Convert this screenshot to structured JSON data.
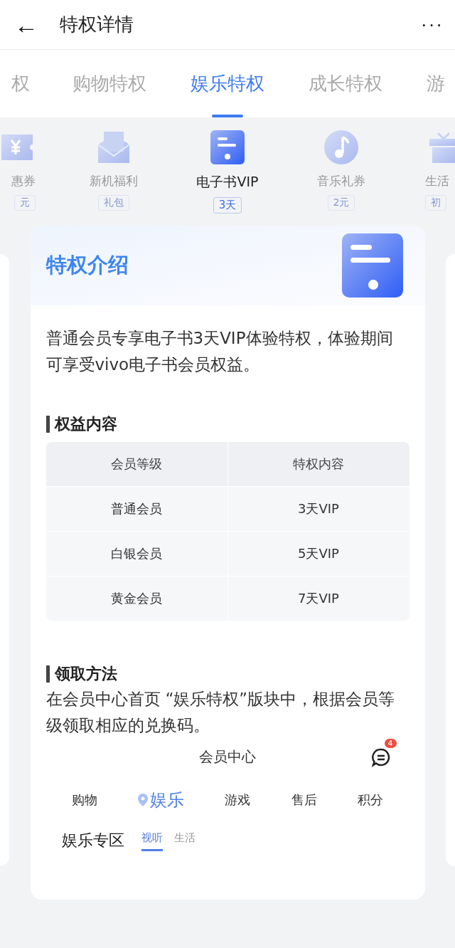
{
  "header": {
    "title": "特权详情",
    "back": "←",
    "more": "···"
  },
  "tabs": [
    {
      "label": "权",
      "selected": false
    },
    {
      "label": "购物特权",
      "selected": false
    },
    {
      "label": "娱乐特权",
      "selected": true
    },
    {
      "label": "成长特权",
      "selected": false
    },
    {
      "label": "游",
      "selected": false
    }
  ],
  "perks": [
    {
      "kind": "ticket",
      "label": "惠券",
      "badge": "元",
      "selected": false
    },
    {
      "kind": "mail",
      "label": "新机福利",
      "badge": "礼包",
      "selected": false
    },
    {
      "kind": "book",
      "label": "电子书VIP",
      "badge": "3天",
      "selected": true
    },
    {
      "kind": "music",
      "label": "音乐礼券",
      "badge": "2元",
      "selected": false
    },
    {
      "kind": "gift",
      "label": "生活",
      "badge": "初",
      "selected": false
    }
  ],
  "card": {
    "title": "特权介绍",
    "intro": "普通会员专享电子书3天VIP体验特权，体验期间可享受vivo电子书会员权益。",
    "benefits_heading": "权益内容",
    "table": {
      "columns": [
        "会员等级",
        "特权内容"
      ],
      "rows": [
        [
          "普通会员",
          "3天VIP"
        ],
        [
          "白银会员",
          "5天VIP"
        ],
        [
          "黄金会员",
          "7天VIP"
        ]
      ]
    },
    "method_heading": "领取方法",
    "method_text": "在会员中心首页 “娱乐特权”版块中，根据会员等级领取相应的兑换码。",
    "preview": {
      "title": "会员中心",
      "badge": "4",
      "tabs": [
        {
          "label": "购物",
          "selected": false
        },
        {
          "label": "娱乐",
          "selected": true
        },
        {
          "label": "游戏",
          "selected": false
        },
        {
          "label": "售后",
          "selected": false
        },
        {
          "label": "积分",
          "selected": false
        }
      ],
      "section": "娱乐专区",
      "subtabs": [
        {
          "label": "视听",
          "selected": true
        },
        {
          "label": "生活",
          "selected": false
        }
      ]
    }
  }
}
